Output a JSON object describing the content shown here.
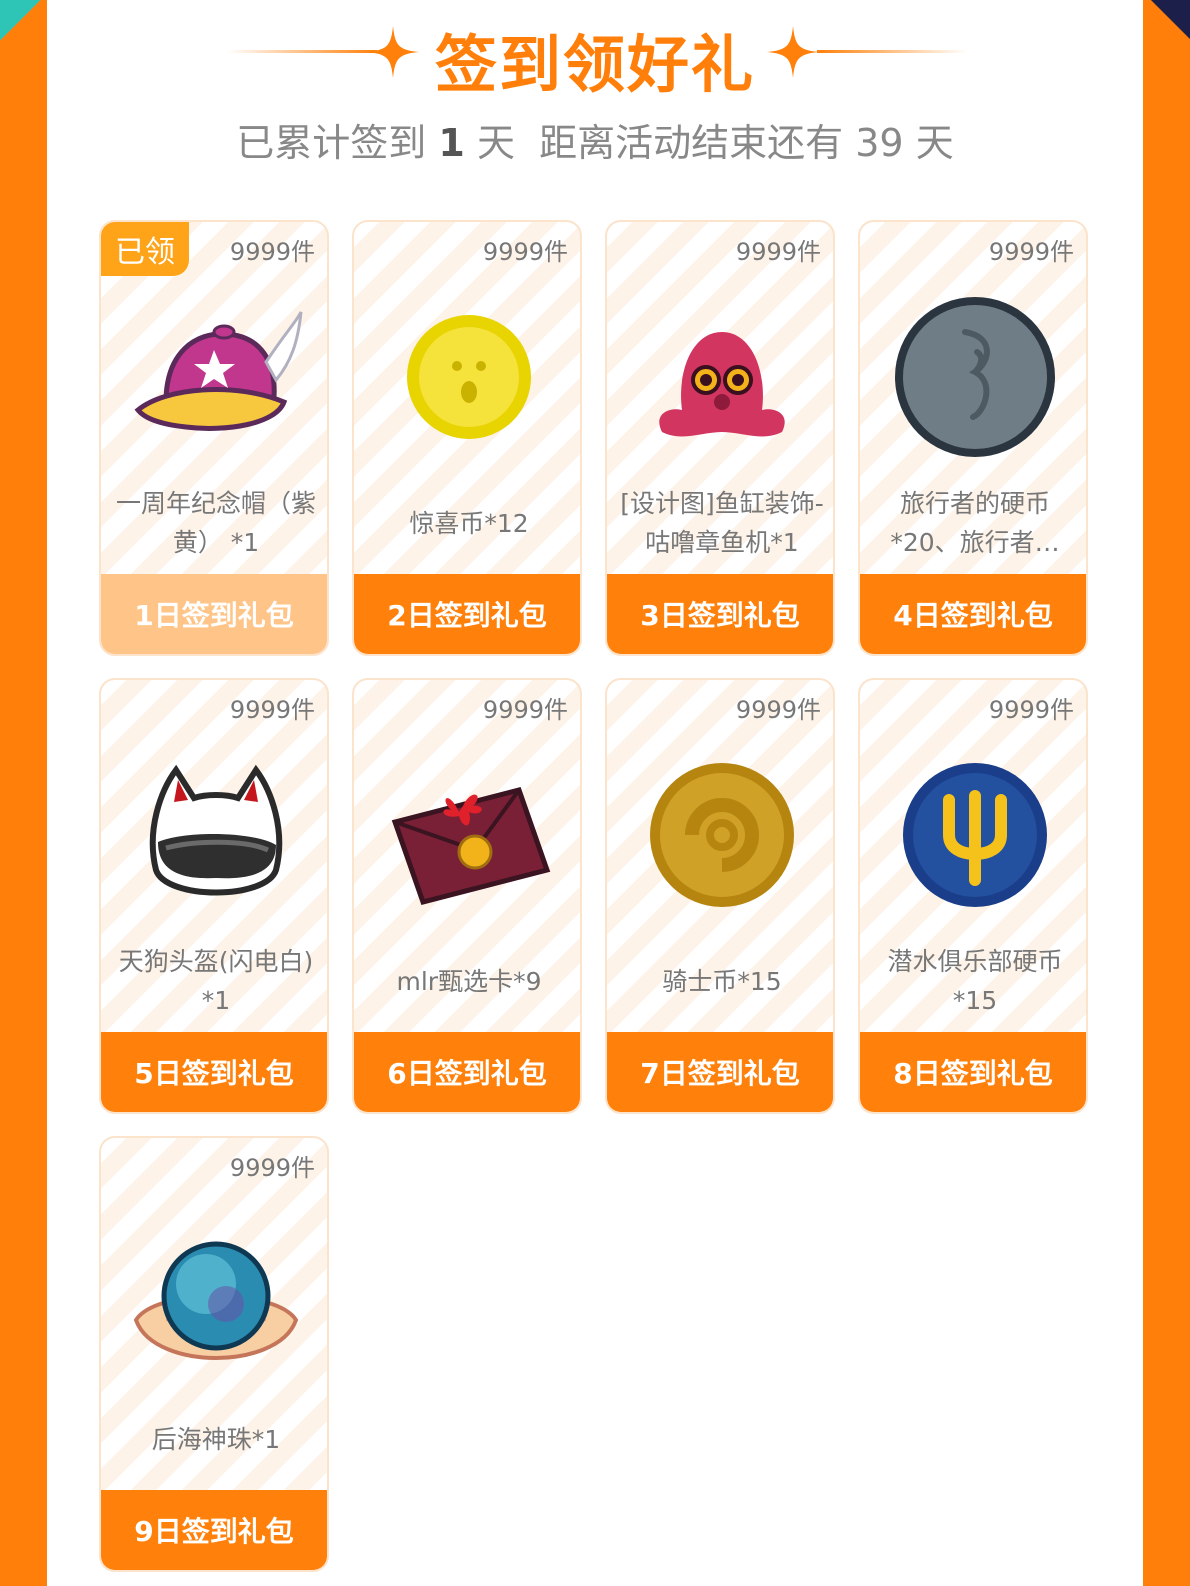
{
  "title": "签到领好礼",
  "subtitle": {
    "prefix": "已累计签到",
    "days": "1",
    "unit1": "天",
    "middle": "距离活动结束还有",
    "remaining": "39",
    "unit2": "天"
  },
  "colors": {
    "accent": "#ff800a",
    "claimed_footer": "#ffc487",
    "badge": "#ffa318"
  },
  "rewards": [
    {
      "badge": "已领",
      "count": "9999件",
      "name": "一周年纪念帽（紫黄） *1",
      "label": "1日签到礼包",
      "icon": "cap-icon",
      "claimed": true
    },
    {
      "count": "9999件",
      "name": "惊喜币*12",
      "label": "2日签到礼包",
      "icon": "surprise-coin-icon"
    },
    {
      "count": "9999件",
      "name": "[设计图]鱼缸装饰-咕噜章鱼机*1",
      "label": "3日签到礼包",
      "icon": "octopus-icon"
    },
    {
      "count": "9999件",
      "name": "旅行者的硬币*20、旅行者…",
      "label": "4日签到礼包",
      "icon": "traveler-coin-icon"
    },
    {
      "count": "9999件",
      "name": "天狗头盔(闪电白) *1",
      "label": "5日签到礼包",
      "icon": "helmet-icon"
    },
    {
      "count": "9999件",
      "name": "mlr甄选卡*9",
      "label": "6日签到礼包",
      "icon": "card-envelope-icon"
    },
    {
      "count": "9999件",
      "name": "骑士币*15",
      "label": "7日签到礼包",
      "icon": "knight-coin-icon"
    },
    {
      "count": "9999件",
      "name": "潜水俱乐部硬币*15",
      "label": "8日签到礼包",
      "icon": "diving-coin-icon"
    },
    {
      "count": "9999件",
      "name": "后海神珠*1",
      "label": "9日签到礼包",
      "icon": "pearl-icon"
    }
  ]
}
